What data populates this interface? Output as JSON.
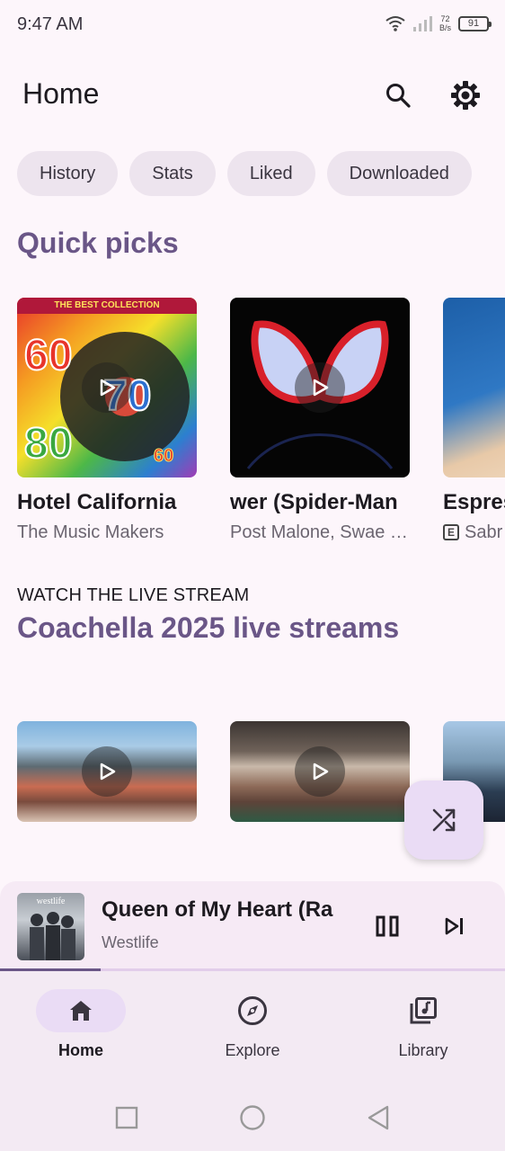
{
  "status_bar": {
    "time": "9:47 AM",
    "net_speed_value": "72",
    "net_speed_unit": "B/s",
    "battery": "91"
  },
  "header": {
    "title": "Home",
    "search_icon": "search-icon",
    "settings_icon": "gear-icon"
  },
  "chips": [
    {
      "label": "History"
    },
    {
      "label": "Stats"
    },
    {
      "label": "Liked"
    },
    {
      "label": "Downloaded"
    }
  ],
  "quick_picks": {
    "title": "Quick picks",
    "items": [
      {
        "title": "Hotel California",
        "subtitle": "The Music Makers",
        "explicit": false,
        "art_text": "THE BEST COLLECTION"
      },
      {
        "title": "wer (Spider-Man",
        "subtitle": "Post Malone, Swae Lee",
        "explicit": false
      },
      {
        "title": "Espres",
        "subtitle": "Sabr",
        "explicit": true,
        "explicit_mark": "E"
      }
    ]
  },
  "live_section": {
    "overline": "WATCH THE LIVE STREAM",
    "title": "Coachella 2025 live streams"
  },
  "fab": {
    "icon": "shuffle-icon"
  },
  "mini_player": {
    "title": "Queen of My Heart (Ra",
    "artist": "Westlife",
    "art_text": "westlife",
    "progress": 0.2,
    "pause_icon": "pause-icon",
    "next_icon": "skip-next-icon"
  },
  "bottom_nav": [
    {
      "label": "Home",
      "icon": "home-icon",
      "active": true
    },
    {
      "label": "Explore",
      "icon": "compass-icon",
      "active": false
    },
    {
      "label": "Library",
      "icon": "library-icon",
      "active": false
    }
  ],
  "colors": {
    "accent": "#6a5687",
    "background": "#fdf6fb",
    "chip": "#ede4ee"
  }
}
